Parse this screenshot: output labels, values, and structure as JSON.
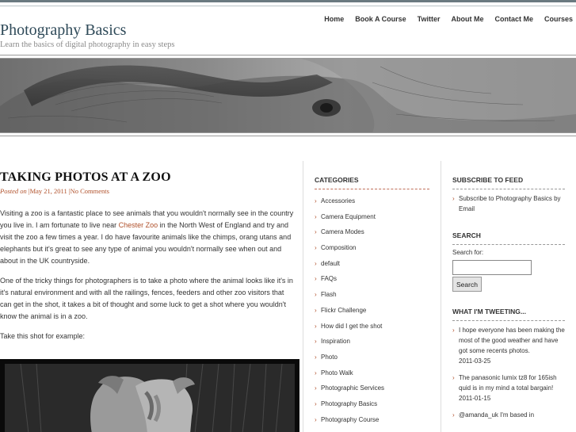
{
  "site": {
    "title": "Photography Basics",
    "tagline": "Learn the basics of digital photography in easy steps"
  },
  "nav": [
    "Home",
    "Book A Course",
    "Twitter",
    "About Me",
    "Contact Me",
    "Courses"
  ],
  "post": {
    "title": "TAKING PHOTOS AT A ZOO",
    "posted_on": "Posted on",
    "date": "May 21, 2011",
    "separator": "|",
    "comments": "No Comments",
    "p1_before": "Visiting a zoo is a fantastic place to see animals that you wouldn't normally see in the country you live in. I am fortunate to live near ",
    "p1_link": "Chester Zoo",
    "p1_after": " in the North West of England and try and visit the zoo a few times a year. I do have favourite animals like the chimps, orang utans and elephants but it's great to see any type of animal you wouldn't normally see when out and about in the UK countryside.",
    "p2": "One of the tricky things for photographers is to take a photo where the animal looks like it's in it's natural environment and with all the railings, fences, feeders and other zoo visitors that can get in the shot, it takes a bit of thought and some luck to get a shot where you wouldn't know the animal is in a zoo.",
    "p3": "Take this shot for example:"
  },
  "categories": {
    "title": "CATEGORIES",
    "items": [
      "Accessories",
      "Camera Equipment",
      "Camera Modes",
      "Composition",
      "default",
      "FAQs",
      "Flash",
      "Flickr Challenge",
      "How did I get the shot",
      "Inspiration",
      "Photo",
      "Photo Walk",
      "Photographic Services",
      "Photography Basics",
      "Photography Course"
    ]
  },
  "subscribe": {
    "title": "SUBSCRIBE TO FEED",
    "items": [
      "Subscribe to Photography Basics by Email"
    ]
  },
  "search": {
    "title": "SEARCH",
    "label": "Search for:",
    "value": "",
    "button": "Search"
  },
  "tweets": {
    "title": "WHAT I'M TWEETING...",
    "items": [
      {
        "text": "I hope everyone has been making the most of the good weather and have got some recents photos.",
        "date": "2011-03-25"
      },
      {
        "text": "The panasonic lumix tz8 for 165ish quid is in my mind a total bargain!",
        "date": "2011-01-15"
      },
      {
        "text": "@amanda_uk I'm based in",
        "date": ""
      }
    ]
  },
  "icons": {
    "bullet": "chevron-right-icon"
  },
  "colors": {
    "accent": "#b0502a",
    "title": "#2f4a59"
  }
}
